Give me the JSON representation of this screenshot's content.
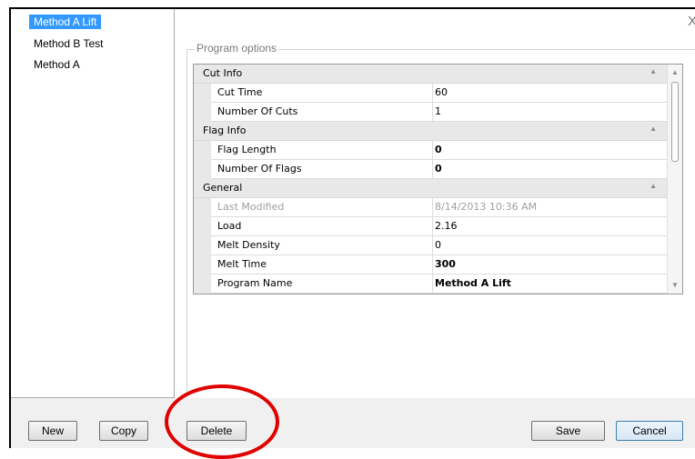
{
  "window": {
    "close_label": "X"
  },
  "methods_list": [
    "Method A Lift",
    "Method B Test",
    "Method A"
  ],
  "program_options": {
    "title": "Program options",
    "categories": [
      {
        "name": "Cut Info",
        "properties": [
          {
            "name": "Cut Time",
            "value": "60"
          },
          {
            "name": "Number Of Cuts",
            "value": "1"
          }
        ]
      },
      {
        "name": "Flag Info",
        "properties": [
          {
            "name": "Flag Length",
            "value": "0"
          },
          {
            "name": "Number Of Flags",
            "value": "0"
          }
        ]
      },
      {
        "name": "General",
        "properties": [
          {
            "name": "Last Modified",
            "value": "8/14/2013 10:36 AM"
          },
          {
            "name": "Load",
            "value": "2.16"
          },
          {
            "name": "Melt Density",
            "value": "0"
          },
          {
            "name": "Melt Time",
            "value": "300"
          },
          {
            "name": "Program Name",
            "value": "Method A Lift"
          }
        ]
      }
    ]
  },
  "buttons": {
    "new": "New",
    "copy": "Copy",
    "delete": "Delete",
    "save": "Save",
    "cancel": "Cancel"
  },
  "icons": {
    "collapse": "chevron-up-icon",
    "scroll_up": "triangle-up-icon",
    "scroll_down": "triangle-down-icon"
  },
  "colors": {
    "selection": "#3399ff",
    "annotation": "#e00000"
  }
}
